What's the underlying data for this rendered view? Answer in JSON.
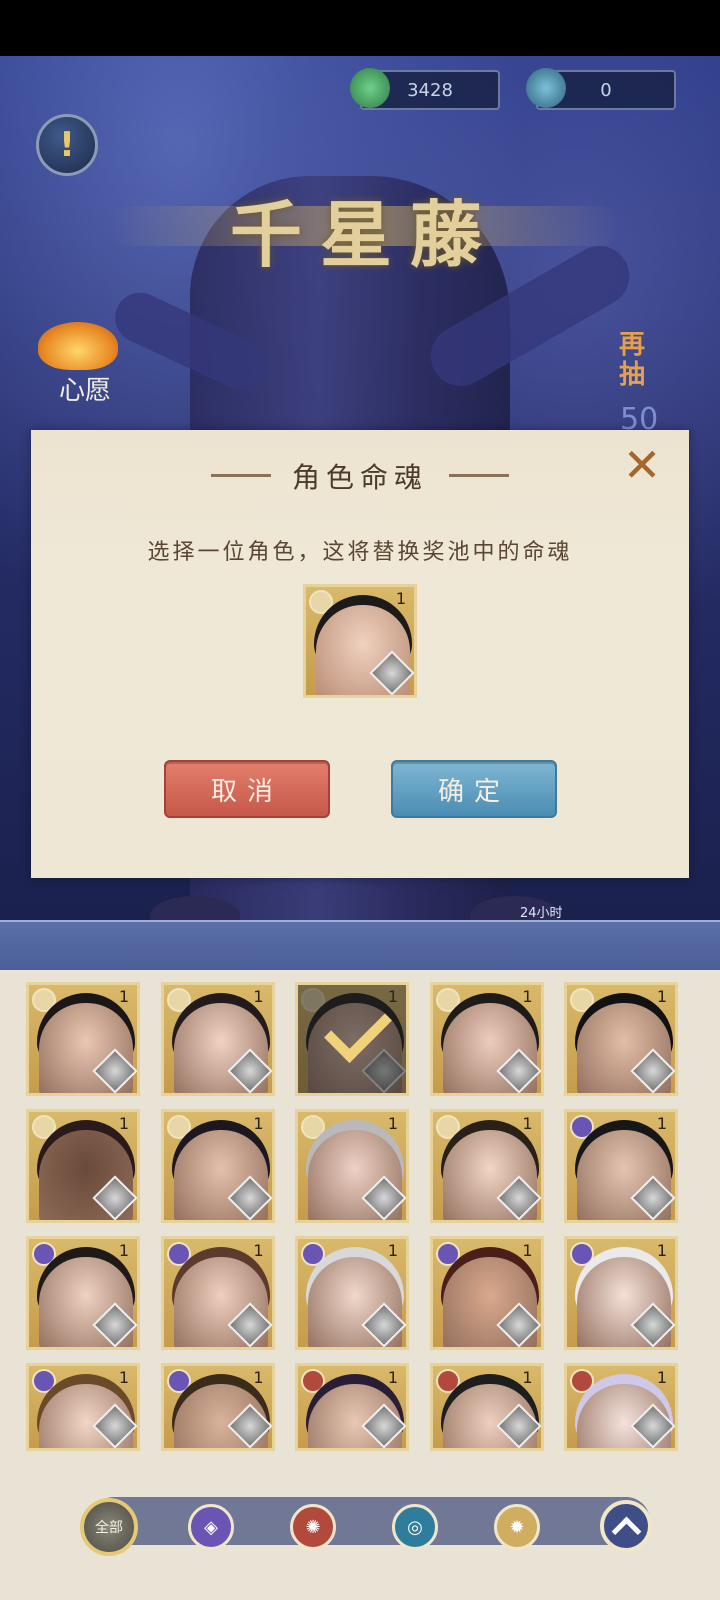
{
  "currency": [
    {
      "icon": "jade-coin-icon",
      "value": "3428"
    },
    {
      "icon": "spirit-gem-icon",
      "value": "0"
    }
  ],
  "title": "千星藤",
  "wish_label": "心愿",
  "redraw_label": "再抽",
  "redraw_count": "50",
  "timer_text": "24小时",
  "dialog": {
    "title": "角色命魂",
    "description": "选择一位角色，这将替换奖池中的命魂",
    "selected_level": "1",
    "cancel_label": "取消",
    "confirm_label": "确定"
  },
  "cards": [
    {
      "level": "1",
      "element": "gold",
      "selected": false
    },
    {
      "level": "1",
      "element": "gold",
      "selected": false
    },
    {
      "level": "1",
      "element": "gold",
      "selected": true
    },
    {
      "level": "1",
      "element": "gold",
      "selected": false
    },
    {
      "level": "1",
      "element": "gold",
      "selected": false
    },
    {
      "level": "1",
      "element": "gold",
      "selected": false
    },
    {
      "level": "1",
      "element": "gold",
      "selected": false
    },
    {
      "level": "1",
      "element": "gold",
      "selected": false
    },
    {
      "level": "1",
      "element": "gold",
      "selected": false
    },
    {
      "level": "1",
      "element": "purple",
      "selected": false
    },
    {
      "level": "1",
      "element": "purple",
      "selected": false
    },
    {
      "level": "1",
      "element": "purple",
      "selected": false
    },
    {
      "level": "1",
      "element": "purple",
      "selected": false
    },
    {
      "level": "1",
      "element": "purple",
      "selected": false
    },
    {
      "level": "1",
      "element": "purple",
      "selected": false
    },
    {
      "level": "1",
      "element": "purple",
      "selected": false
    },
    {
      "level": "1",
      "element": "purple",
      "selected": false
    },
    {
      "level": "1",
      "element": "red",
      "selected": false
    },
    {
      "level": "1",
      "element": "red",
      "selected": false
    },
    {
      "level": "1",
      "element": "red",
      "selected": false
    }
  ],
  "filters": {
    "all_label": "全部",
    "items": [
      "purple-element-icon",
      "red-element-icon",
      "teal-element-icon",
      "gold-element-icon"
    ]
  },
  "colors": {
    "gold": "#e8d6a6",
    "purple": "#6a55b5",
    "red": "#b14a3d"
  }
}
